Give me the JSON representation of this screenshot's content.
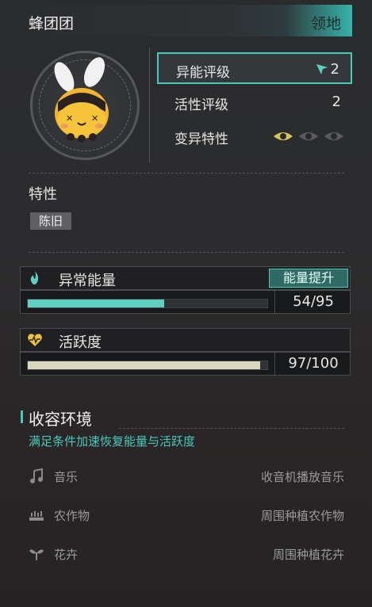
{
  "header": {
    "name": "蜂团团",
    "territory": "领地"
  },
  "stats": [
    {
      "label": "异能评级",
      "value": "2"
    },
    {
      "label": "活性评级",
      "value": "2"
    },
    {
      "label": "变异特性",
      "value": ""
    }
  ],
  "traits": {
    "title": "特性",
    "chips": [
      "陈旧"
    ]
  },
  "energy": {
    "title": "异常能量",
    "boost_label": "能量提升",
    "value_text": "54/95",
    "fraction": 0.568,
    "color": "#5ed0bf"
  },
  "activity": {
    "title": "活跃度",
    "value_text": "97/100",
    "fraction": 0.97,
    "color": "#d9d7bd"
  },
  "environment": {
    "title": "收容环境",
    "subtitle": "满足条件加速恢复能量与活跃度",
    "items": [
      {
        "icon": "music-note-icon",
        "label": "音乐",
        "requirement": "收音机播放音乐"
      },
      {
        "icon": "crop-field-icon",
        "label": "农作物",
        "requirement": "周围种植农作物"
      },
      {
        "icon": "sprout-icon",
        "label": "花卉",
        "requirement": "周围种植花卉"
      }
    ]
  }
}
